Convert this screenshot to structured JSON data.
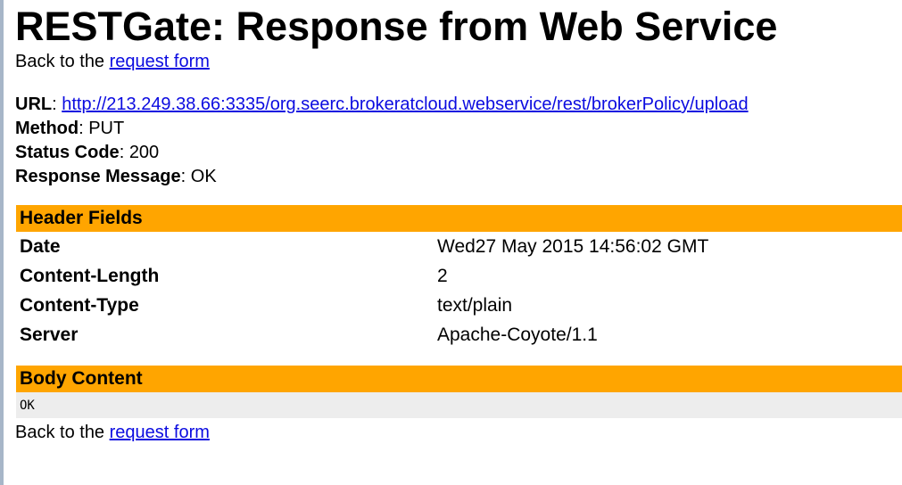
{
  "page_title": "RESTGate: Response from Web Service",
  "back_link": {
    "prefix": "Back to the ",
    "link_text": "request form"
  },
  "request": {
    "url_label": "URL",
    "url": "http://213.249.38.66:3335/org.seerc.brokeratcloud.webservice/rest/brokerPolicy/upload",
    "method_label": "Method",
    "method": "PUT",
    "status_label": "Status Code",
    "status": "200",
    "message_label": "Response Message",
    "message": "OK",
    "separator": ": "
  },
  "header_fields": {
    "title": "Header Fields",
    "rows": [
      {
        "name": "Date",
        "value": "Wed27 May 2015 14:56:02 GMT"
      },
      {
        "name": "Content-Length",
        "value": "2"
      },
      {
        "name": "Content-Type",
        "value": "text/plain"
      },
      {
        "name": "Server",
        "value": "Apache-Coyote/1.1"
      }
    ]
  },
  "body_content": {
    "title": "Body Content",
    "text": "OK"
  },
  "colors": {
    "section_header_bg": "#ffa500",
    "body_bg": "#ededed",
    "link": "#0b0be0"
  }
}
